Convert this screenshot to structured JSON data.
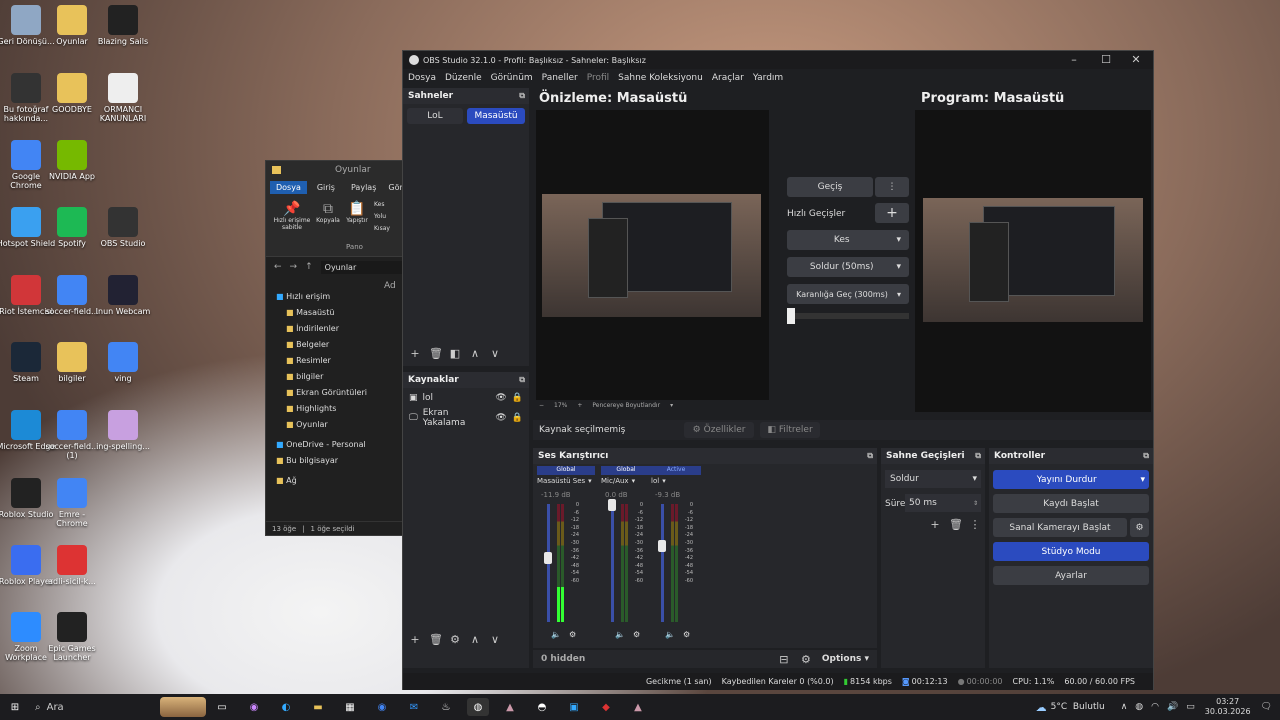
{
  "desktop_icons": [
    {
      "label": "Geri Dönüşü...",
      "icon": "recycle-bin-icon",
      "color": "#8fa7c4"
    },
    {
      "label": "Oyunlar",
      "icon": "folder-icon",
      "color": "#e8c25a"
    },
    {
      "label": "Blazing Sails",
      "icon": "epic-games-icon",
      "color": "#222"
    },
    {
      "label": "Bu fotoğraf hakkında...",
      "icon": "info-icon",
      "color": "#333"
    },
    {
      "label": "GOODBYE",
      "icon": "folder-icon",
      "color": "#e8c25a"
    },
    {
      "label": "ORMANCI KANUNLARI",
      "icon": "document-icon",
      "color": "#eee"
    },
    {
      "label": "Google Chrome",
      "icon": "chrome-icon",
      "color": "#4285f4"
    },
    {
      "label": "NVIDIA App",
      "icon": "nvidia-icon",
      "color": "#76b900"
    },
    {
      "label": "Hotspot Shield",
      "icon": "hotspot-icon",
      "color": "#3aa0f0"
    },
    {
      "label": "Spotify",
      "icon": "spotify-icon",
      "color": "#1db954"
    },
    {
      "label": "OBS Studio",
      "icon": "obs-icon",
      "color": "#333"
    },
    {
      "label": "Riot İstemcisi",
      "icon": "riot-icon",
      "color": "#d13639"
    },
    {
      "label": "soccer-field...",
      "icon": "chrome-icon",
      "color": "#4285f4"
    },
    {
      "label": "Inun Webcam",
      "icon": "webcam-icon",
      "color": "#223"
    },
    {
      "label": "Steam",
      "icon": "steam-icon",
      "color": "#1b2838"
    },
    {
      "label": "bilgiler",
      "icon": "folder-icon",
      "color": "#e8c25a"
    },
    {
      "label": "ving",
      "icon": "chrome-icon",
      "color": "#4285f4"
    },
    {
      "label": "Microsoft Edge",
      "icon": "edge-icon",
      "color": "#1c8ad6"
    },
    {
      "label": "soccer-field... (1)",
      "icon": "chrome-icon",
      "color": "#4285f4"
    },
    {
      "label": "ing-spelling...",
      "icon": "image-icon",
      "color": "#c8a0e0"
    },
    {
      "label": "Roblox Studio",
      "icon": "roblox-icon",
      "color": "#222"
    },
    {
      "label": "Emre - Chrome",
      "icon": "chrome-icon",
      "color": "#4285f4"
    },
    {
      "label": "Roblox Player",
      "icon": "roblox-icon",
      "color": "#3a6df0"
    },
    {
      "label": "adli-sicil-k...",
      "icon": "pdf-icon",
      "color": "#d33"
    },
    {
      "label": "Zoom Workplace",
      "icon": "zoom-icon",
      "color": "#2d8cff"
    },
    {
      "label": "Epic Games Launcher",
      "icon": "epic-games-icon",
      "color": "#222"
    }
  ],
  "explorer": {
    "title": "Oyunlar",
    "ribbon_tabs": [
      "Dosya",
      "Giriş",
      "Paylaş",
      "Görü"
    ],
    "ribbon_buttons": [
      "Hızlı erişime sabitle",
      "Kopyala",
      "Yapıştır"
    ],
    "ribbon_small": [
      "Kes",
      "Yolu",
      "Kısay"
    ],
    "group_label": "Pano",
    "path": "Oyunlar",
    "col_header": "Ad",
    "nav": [
      "Hızlı erişim",
      "Masaüstü",
      "İndirilenler",
      "Belgeler",
      "Resimler",
      "bilgiler",
      "Ekran Görüntüleri",
      "Highlights",
      "Oyunlar",
      "OneDrive - Personal",
      "Bu bilgisayar",
      "Ağ"
    ],
    "status_count": "13 öğe",
    "status_selected": "1 öğe seçildi"
  },
  "obs": {
    "title": "OBS Studio 32.1.0 - Profil: Başlıksız - Sahneler: Başlıksız",
    "menu": [
      "Dosya",
      "Düzenle",
      "Görünüm",
      "Paneller",
      "Profil",
      "Sahne Koleksiyonu",
      "Araçlar",
      "Yardım"
    ],
    "scenes": {
      "title": "Sahneler",
      "items": [
        "LoL",
        "Masaüstü"
      ],
      "active": "Masaüstü"
    },
    "sources": {
      "title": "Kaynaklar",
      "items": [
        "lol",
        "Ekran Yakalama"
      ]
    },
    "preview_label": "Önizleme: Masaüstü",
    "program_label": "Program: Masaüstü",
    "zoom": "17%",
    "zoom_mode": "Pencereye Boyutlandır",
    "transition": {
      "button": "Geçiş",
      "quick_label": "Hızlı Geçişler",
      "items": [
        "Kes",
        "Soldur (50ms)",
        "Karanlığa Geç (300ms)"
      ]
    },
    "source_bar": {
      "status": "Kaynak seçilmemiş",
      "props": "Özellikler",
      "filters": "Filtreler"
    },
    "mixer": {
      "title": "Ses Karıştırıcı",
      "channels": [
        {
          "badge": "Global",
          "name": "Masaüstü Ses",
          "db": "-11.9 dB",
          "level": 0.55
        },
        {
          "badge": "Global",
          "name": "Mic/Aux",
          "db": "0.0 dB",
          "level": 1.0
        },
        {
          "badge": "Active",
          "name": "lol",
          "db": "-9.3 dB",
          "level": 0.65
        }
      ],
      "ticks": [
        "0",
        "-6",
        "-12",
        "-18",
        "-24",
        "-30",
        "-36",
        "-42",
        "-48",
        "-54",
        "-60"
      ],
      "hidden": "0 hidden",
      "options": "Options"
    },
    "scene_transitions": {
      "title": "Sahne Geçişleri",
      "selected": "Soldur",
      "duration_label": "Süre",
      "duration": "50 ms"
    },
    "controls": {
      "title": "Kontroller",
      "stop_stream": "Yayını Durdur",
      "start_record": "Kaydı Başlat",
      "virtual_cam": "Sanal Kamerayı Başlat",
      "studio_mode": "Stüdyo Modu",
      "settings": "Ayarlar"
    },
    "status": {
      "delay": "Gecikme (1 san)",
      "dropped": "Kaybedilen Kareler 0 (%0.0)",
      "bitrate": "8154 kbps",
      "stream_time": "00:12:13",
      "rec_time": "00:00:00",
      "cpu": "CPU: 1.1%",
      "fps": "60.00 / 60.00 FPS"
    }
  },
  "taskbar": {
    "search": "Ara",
    "weather": "5°C  Bulutlu",
    "time": "03:27",
    "date": "30.03.2026"
  }
}
